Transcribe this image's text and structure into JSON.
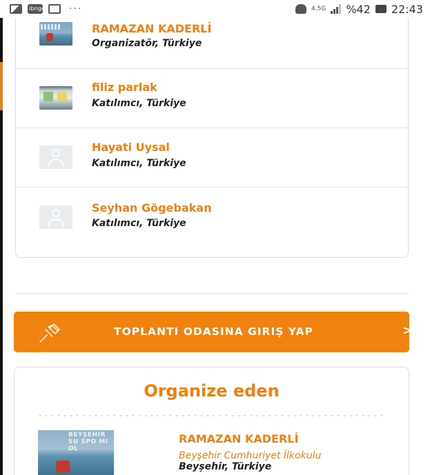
{
  "status_bar": {
    "icons": [
      "image-icon",
      "brand-icon",
      "mail-icon"
    ],
    "brand_text": "ibrige",
    "overflow": "···",
    "network": "4.5G",
    "battery": "%42",
    "time": "22:43"
  },
  "participants": [
    {
      "name": "RAMAZAN KADERLİ",
      "role": "Organizatör, Türkiye",
      "avatar": "photo-lake"
    },
    {
      "name": "filiz parlak",
      "role": "Katılımcı, Türkiye",
      "avatar": "photo-board"
    },
    {
      "name": "Hayati Uysal",
      "role": "Katılımcı, Türkiye",
      "avatar": "placeholder"
    },
    {
      "name": "Seyhan Gögebakan",
      "role": "Katılımcı, Türkiye",
      "avatar": "placeholder"
    }
  ],
  "cta": {
    "label": "TOPLANTI ODASINA GIRIŞ YAP",
    "arrow": ">",
    "icon": "pin-icon"
  },
  "organizer": {
    "section_title": "Organize eden",
    "photo_text": "BEYŞEHIR SU SPO MI OL",
    "name": "RAMAZAN KADERLİ",
    "school": "Beyşehir Cumhuriyet İlkokulu",
    "location": "Beyşehir, Türkiye"
  },
  "colors": {
    "accent": "#f07f10",
    "button": "#f0820f",
    "text_dark": "#222222",
    "border": "#dcdcdc"
  }
}
